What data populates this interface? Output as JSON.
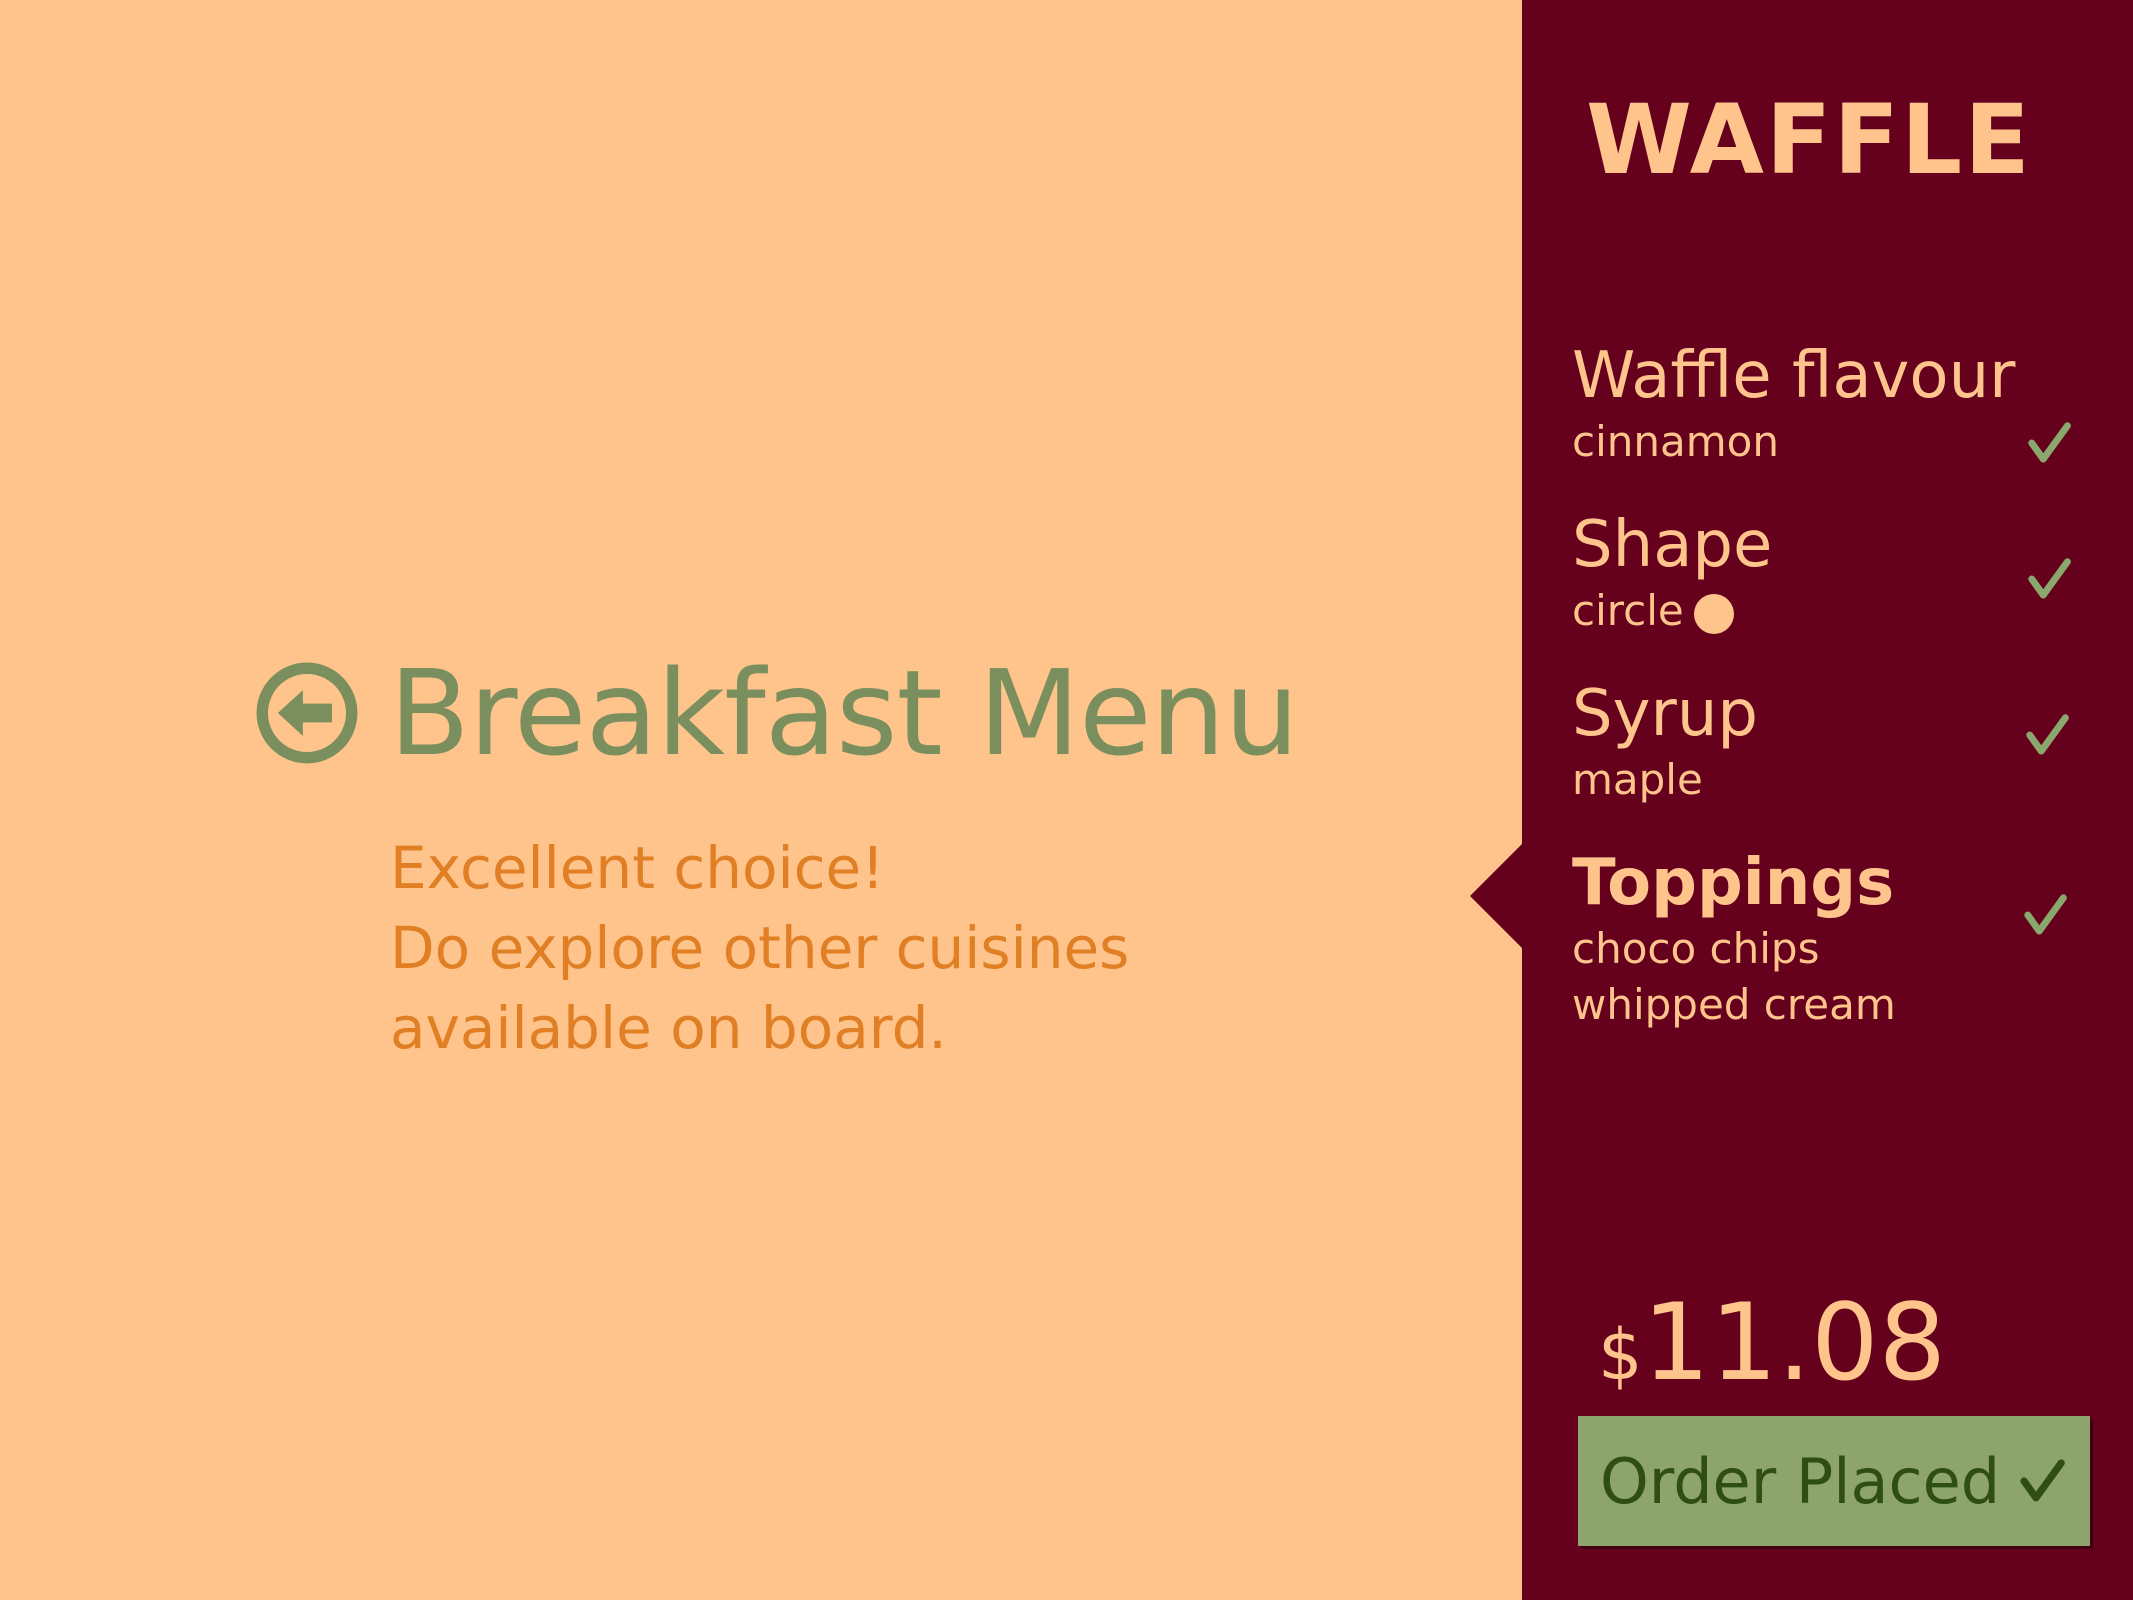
{
  "colors": {
    "background": "#fec48c",
    "sidebar": "#65011d",
    "accent_green": "#7a8e5e",
    "message_orange": "#e07f24",
    "button_green": "#8da46e",
    "check_green": "#8aa86e"
  },
  "main": {
    "back_icon": "arrow-left-circle-icon",
    "title": "Breakfast Menu",
    "message": {
      "line1": "Excellent choice!",
      "line2": "Do explore other cuisines",
      "line3": "available on board."
    }
  },
  "order": {
    "title": "WAFFLE",
    "options": [
      {
        "label": "Waffle flavour",
        "value": "cinnamon",
        "checked": true
      },
      {
        "label": "Shape",
        "value": "circle",
        "icon": "circle-shape-icon",
        "checked": true
      },
      {
        "label": "Syrup",
        "value": "maple",
        "checked": true
      },
      {
        "label": "Toppings",
        "values": [
          "choco chips",
          "whipped cream"
        ],
        "checked": true,
        "active": true
      }
    ],
    "price_currency": "$",
    "price_amount": "11.08",
    "button_label": "Order Placed",
    "button_icon": "check-icon"
  }
}
